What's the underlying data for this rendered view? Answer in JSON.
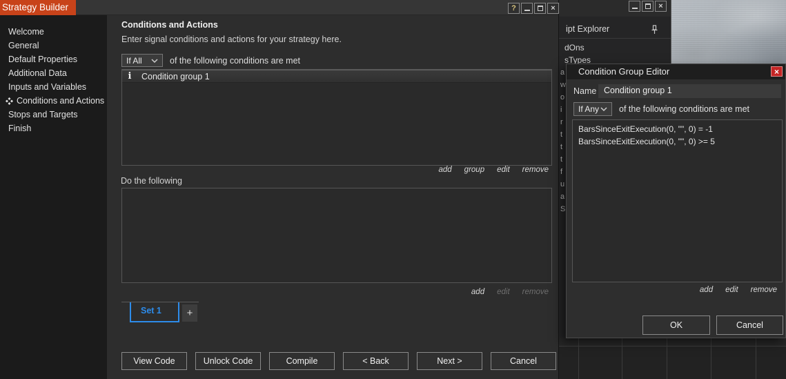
{
  "colors": {
    "accent_orange": "#c8431a",
    "accent_blue": "#2d8ceb",
    "close_red": "#c42525",
    "window_bg": "#2d2d2d",
    "sidebar_bg": "#1b1b1b"
  },
  "icons": {
    "help": "?",
    "close": "×",
    "info": "i",
    "add_tab": "+"
  },
  "sb": {
    "title": "Strategy Builder",
    "sidebar": {
      "items": [
        {
          "label": "Welcome"
        },
        {
          "label": "General"
        },
        {
          "label": "Default Properties"
        },
        {
          "label": "Additional Data"
        },
        {
          "label": "Inputs and Variables"
        },
        {
          "label": "Conditions and Actions",
          "selected": true
        },
        {
          "label": "Stops and Targets"
        },
        {
          "label": "Finish"
        }
      ]
    },
    "main": {
      "heading": "Conditions and Actions",
      "subheading": "Enter signal conditions and actions for your strategy here.",
      "conditions": {
        "dropdown_value": "If All",
        "dropdown_caption": "of the following conditions are met",
        "items": [
          "Condition group 1"
        ],
        "links": [
          "add",
          "group",
          "edit",
          "remove"
        ]
      },
      "actions": {
        "label": "Do the following",
        "links": [
          "add",
          "edit",
          "remove"
        ]
      },
      "sets": {
        "tab": "Set 1"
      },
      "footer": [
        "View Code",
        "Unlock Code",
        "Compile",
        "< Back",
        "Next >",
        "Cancel"
      ]
    }
  },
  "explorer": {
    "header": "ipt Explorer",
    "items": [
      "dOns",
      "sTypes"
    ],
    "fragments": [
      "a",
      "w",
      "o",
      "i",
      "r",
      "t",
      "t",
      "t",
      "f",
      "u",
      "a",
      "S"
    ]
  },
  "dialog": {
    "title": "Condition Group Editor",
    "name_label": "Name",
    "name_value": "Condition group 1",
    "dropdown_value": "If Any",
    "dropdown_caption": "of the following conditions are met",
    "conditions": [
      "BarsSinceExitExecution(0, \"\", 0) = -1",
      "BarsSinceExitExecution(0, \"\", 0) >= 5"
    ],
    "links": [
      "add",
      "edit",
      "remove"
    ],
    "ok_label": "OK",
    "cancel_label": "Cancel"
  }
}
